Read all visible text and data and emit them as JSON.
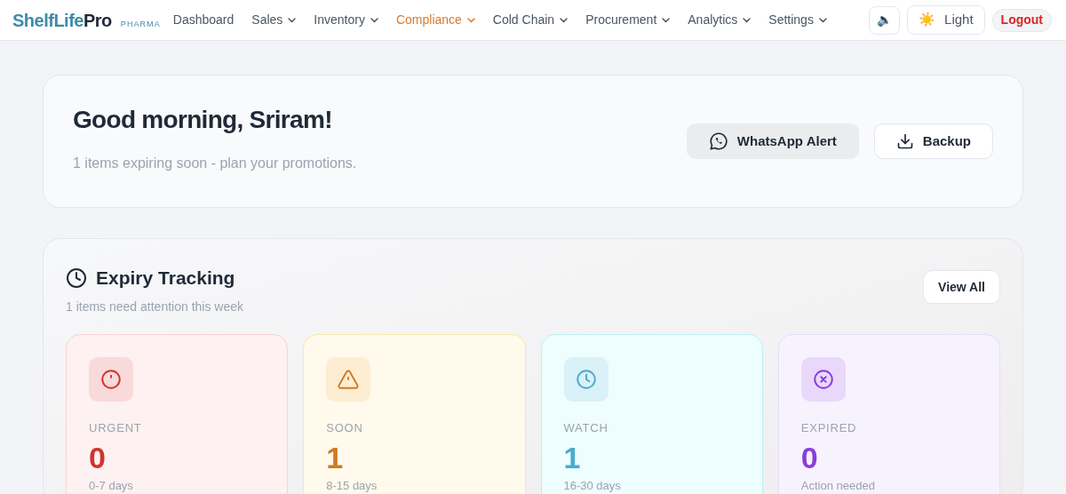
{
  "brand": {
    "name_part_1": "ShelfLife",
    "name_part_2": "Pro",
    "tag": "PHARMA"
  },
  "nav": [
    {
      "label": "Dashboard",
      "selected": false,
      "dropdown": false
    },
    {
      "label": "Sales",
      "selected": false,
      "dropdown": true
    },
    {
      "label": "Inventory",
      "selected": false,
      "dropdown": true
    },
    {
      "label": "Compliance",
      "selected": true,
      "dropdown": true
    },
    {
      "label": "Cold Chain",
      "selected": false,
      "dropdown": true
    },
    {
      "label": "Procurement",
      "selected": false,
      "dropdown": true
    },
    {
      "label": "Analytics",
      "selected": false,
      "dropdown": true
    },
    {
      "label": "Settings",
      "selected": false,
      "dropdown": true
    }
  ],
  "header_actions": {
    "sound_icon": "🔈",
    "theme_icon": "☀️",
    "theme_label": "Light",
    "logout": "Logout"
  },
  "greeting": {
    "title": "Good morning, Sriram!",
    "subtitle": "1 items expiring soon - plan your promotions.",
    "buttons": [
      {
        "kind": "whatsapp",
        "label": "WhatsApp Alert"
      },
      {
        "kind": "backup",
        "label": "Backup"
      }
    ]
  },
  "expiry": {
    "title": "Expiry Tracking",
    "subtitle": "1 items need attention this week",
    "view_all": "View All",
    "cards": [
      {
        "kind": "urgent",
        "label": "URGENT",
        "count": "0",
        "range": "0-7 days"
      },
      {
        "kind": "soon",
        "label": "SOON",
        "count": "1",
        "range": "8-15 days"
      },
      {
        "kind": "watch",
        "label": "WATCH",
        "count": "1",
        "range": "16-30 days"
      },
      {
        "kind": "expired",
        "label": "EXPIRED",
        "count": "0",
        "range": "Action needed"
      }
    ]
  }
}
